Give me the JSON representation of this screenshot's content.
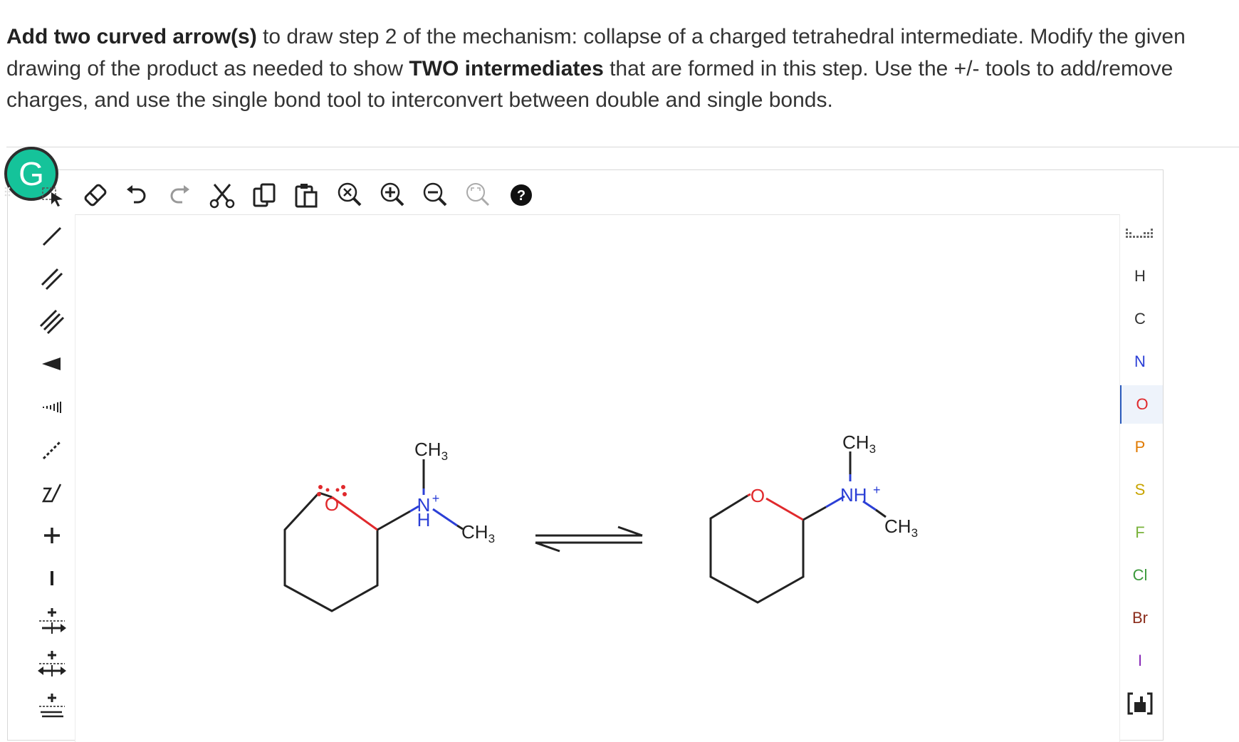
{
  "prompt": {
    "part1": "Add two curved arrow(s)",
    "part2": " to draw step 2 of the mechanism: collapse of a charged tetrahedral intermediate. Modify the given drawing of the product as needed to show ",
    "part3": "TWO intermediates",
    "part4": " that are formed in this step. Use the +/- tools to add/remove charges, and use the single bond tool to interconvert between double and single bonds."
  },
  "grammarly": {
    "letter": "G"
  },
  "toolbar": {
    "icons": [
      "eraser-icon",
      "undo-icon",
      "redo-icon",
      "cut-icon",
      "copy-icon",
      "paste-icon",
      "zoom-reset-icon",
      "zoom-in-icon",
      "zoom-out-icon",
      "zoom-fit-icon",
      "help-icon"
    ],
    "help_label": "?"
  },
  "left_tools": [
    "single-bond",
    "double-bond",
    "triple-bond",
    "wedge-bond",
    "hash-bond",
    "dashed-bond",
    "chain",
    "plus-charge",
    "minus-charge",
    "curved-arrow-pair",
    "curved-arrow-single",
    "resonance-arrow"
  ],
  "elements": {
    "items": [
      "H",
      "C",
      "N",
      "O",
      "P",
      "S",
      "F",
      "Cl",
      "Br",
      "I"
    ],
    "colors": {
      "H": "#333333",
      "C": "#333333",
      "N": "#2b3fd6",
      "O": "#e0292c",
      "P": "#e07a00",
      "S": "#c8a400",
      "F": "#7ab33c",
      "Cl": "#3c9a3c",
      "Br": "#8a2b1a",
      "I": "#8a2bb8"
    },
    "selected": "O"
  },
  "molecules": {
    "left": {
      "O": "O",
      "top_methyl": "CH",
      "top_methyl_sub": "3",
      "N": "N",
      "N_charge": "+",
      "NH": "H",
      "right_methyl": "CH",
      "right_methyl_sub": "3"
    },
    "right": {
      "O": "O",
      "top_methyl": "CH",
      "top_methyl_sub": "3",
      "NH": "NH",
      "NH_charge": "+",
      "right_methyl": "CH",
      "right_methyl_sub": "3"
    },
    "colors": {
      "oxygen": "#e0292c",
      "nitrogen": "#2b3fd6",
      "bond": "#222222"
    }
  }
}
